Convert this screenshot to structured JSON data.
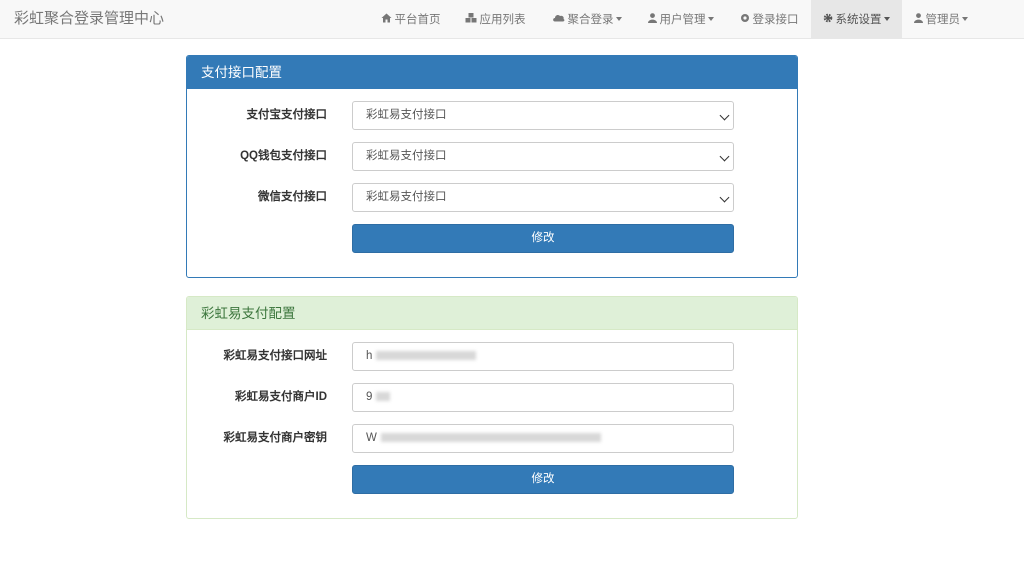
{
  "brand": "彩虹聚合登录管理中心",
  "nav": {
    "home": "平台首页",
    "apps": "应用列表",
    "aggregate_login": "聚合登录",
    "user_management": "用户管理",
    "login_api": "登录接口",
    "system_settings": "系统设置",
    "admin": "管理员"
  },
  "payment_panel": {
    "title": "支付接口配置",
    "alipay_label": "支付宝支付接口",
    "alipay_value": "彩虹易支付接口",
    "qq_label": "QQ钱包支付接口",
    "qq_value": "彩虹易支付接口",
    "wechat_label": "微信支付接口",
    "wechat_value": "彩虹易支付接口",
    "submit": "修改"
  },
  "epay_panel": {
    "title": "彩虹易支付配置",
    "url_label": "彩虹易支付接口网址",
    "url_value": "h",
    "pid_label": "彩虹易支付商户ID",
    "pid_value": "9",
    "key_label": "彩虹易支付商户密钥",
    "key_value": "W",
    "submit": "修改"
  },
  "colors": {
    "primary": "#337ab7",
    "success_bg": "#dff0d8",
    "success_text": "#3c763d"
  }
}
